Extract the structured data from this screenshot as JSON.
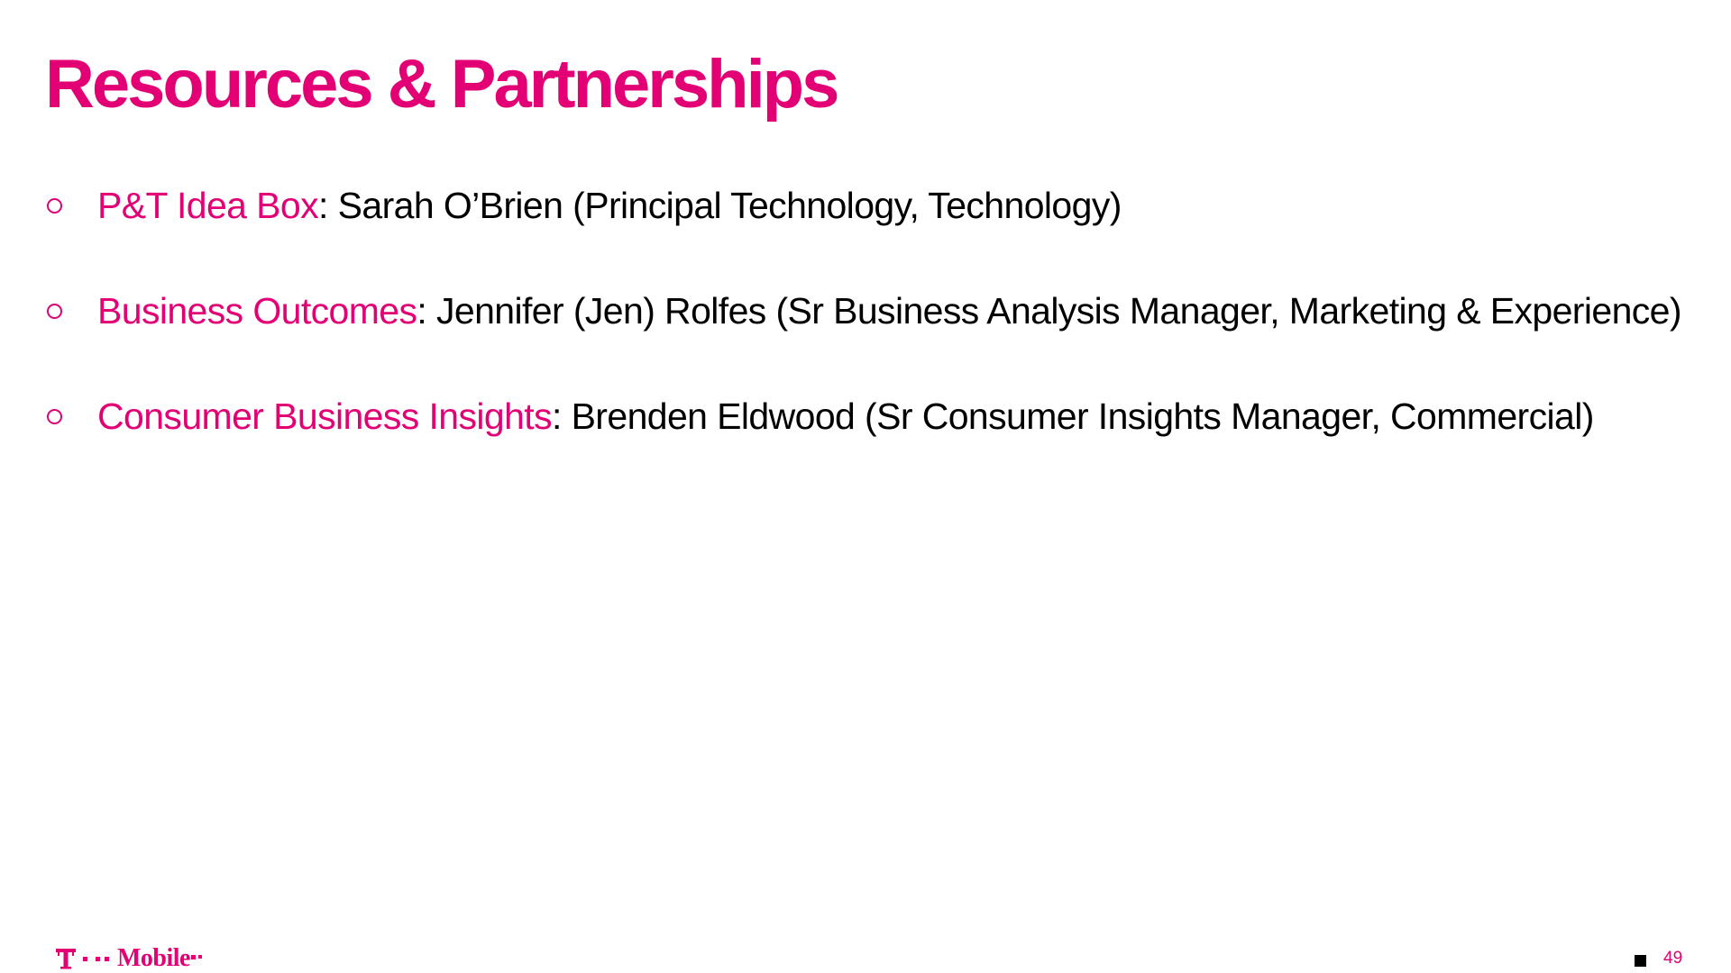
{
  "slide": {
    "title": "Resources & Partnerships",
    "page_number": "49",
    "logo_text": "Mobile",
    "brand_color": "#e20074",
    "text_color": "#000000"
  },
  "bullets": [
    {
      "topic": "P&T Idea Box",
      "separator": ":",
      "person": "Sarah O’Brien",
      "role": "(Principal Technology, Technology)"
    },
    {
      "topic": "Business Outcomes",
      "separator": ":",
      "person": "Jennifer (Jen) Rolfes",
      "role": "(Sr Business Analysis Manager, Marketing & Experience)"
    },
    {
      "topic": "Consumer Business Insights",
      "separator": ":",
      "person": "Brenden Eldwood",
      "role": "(Sr Consumer Insights Manager, Commercial)"
    }
  ],
  "icons": {
    "bullet": "hollow-circle-icon",
    "logo": "t-mobile-logo",
    "page_marker": "square-icon"
  }
}
